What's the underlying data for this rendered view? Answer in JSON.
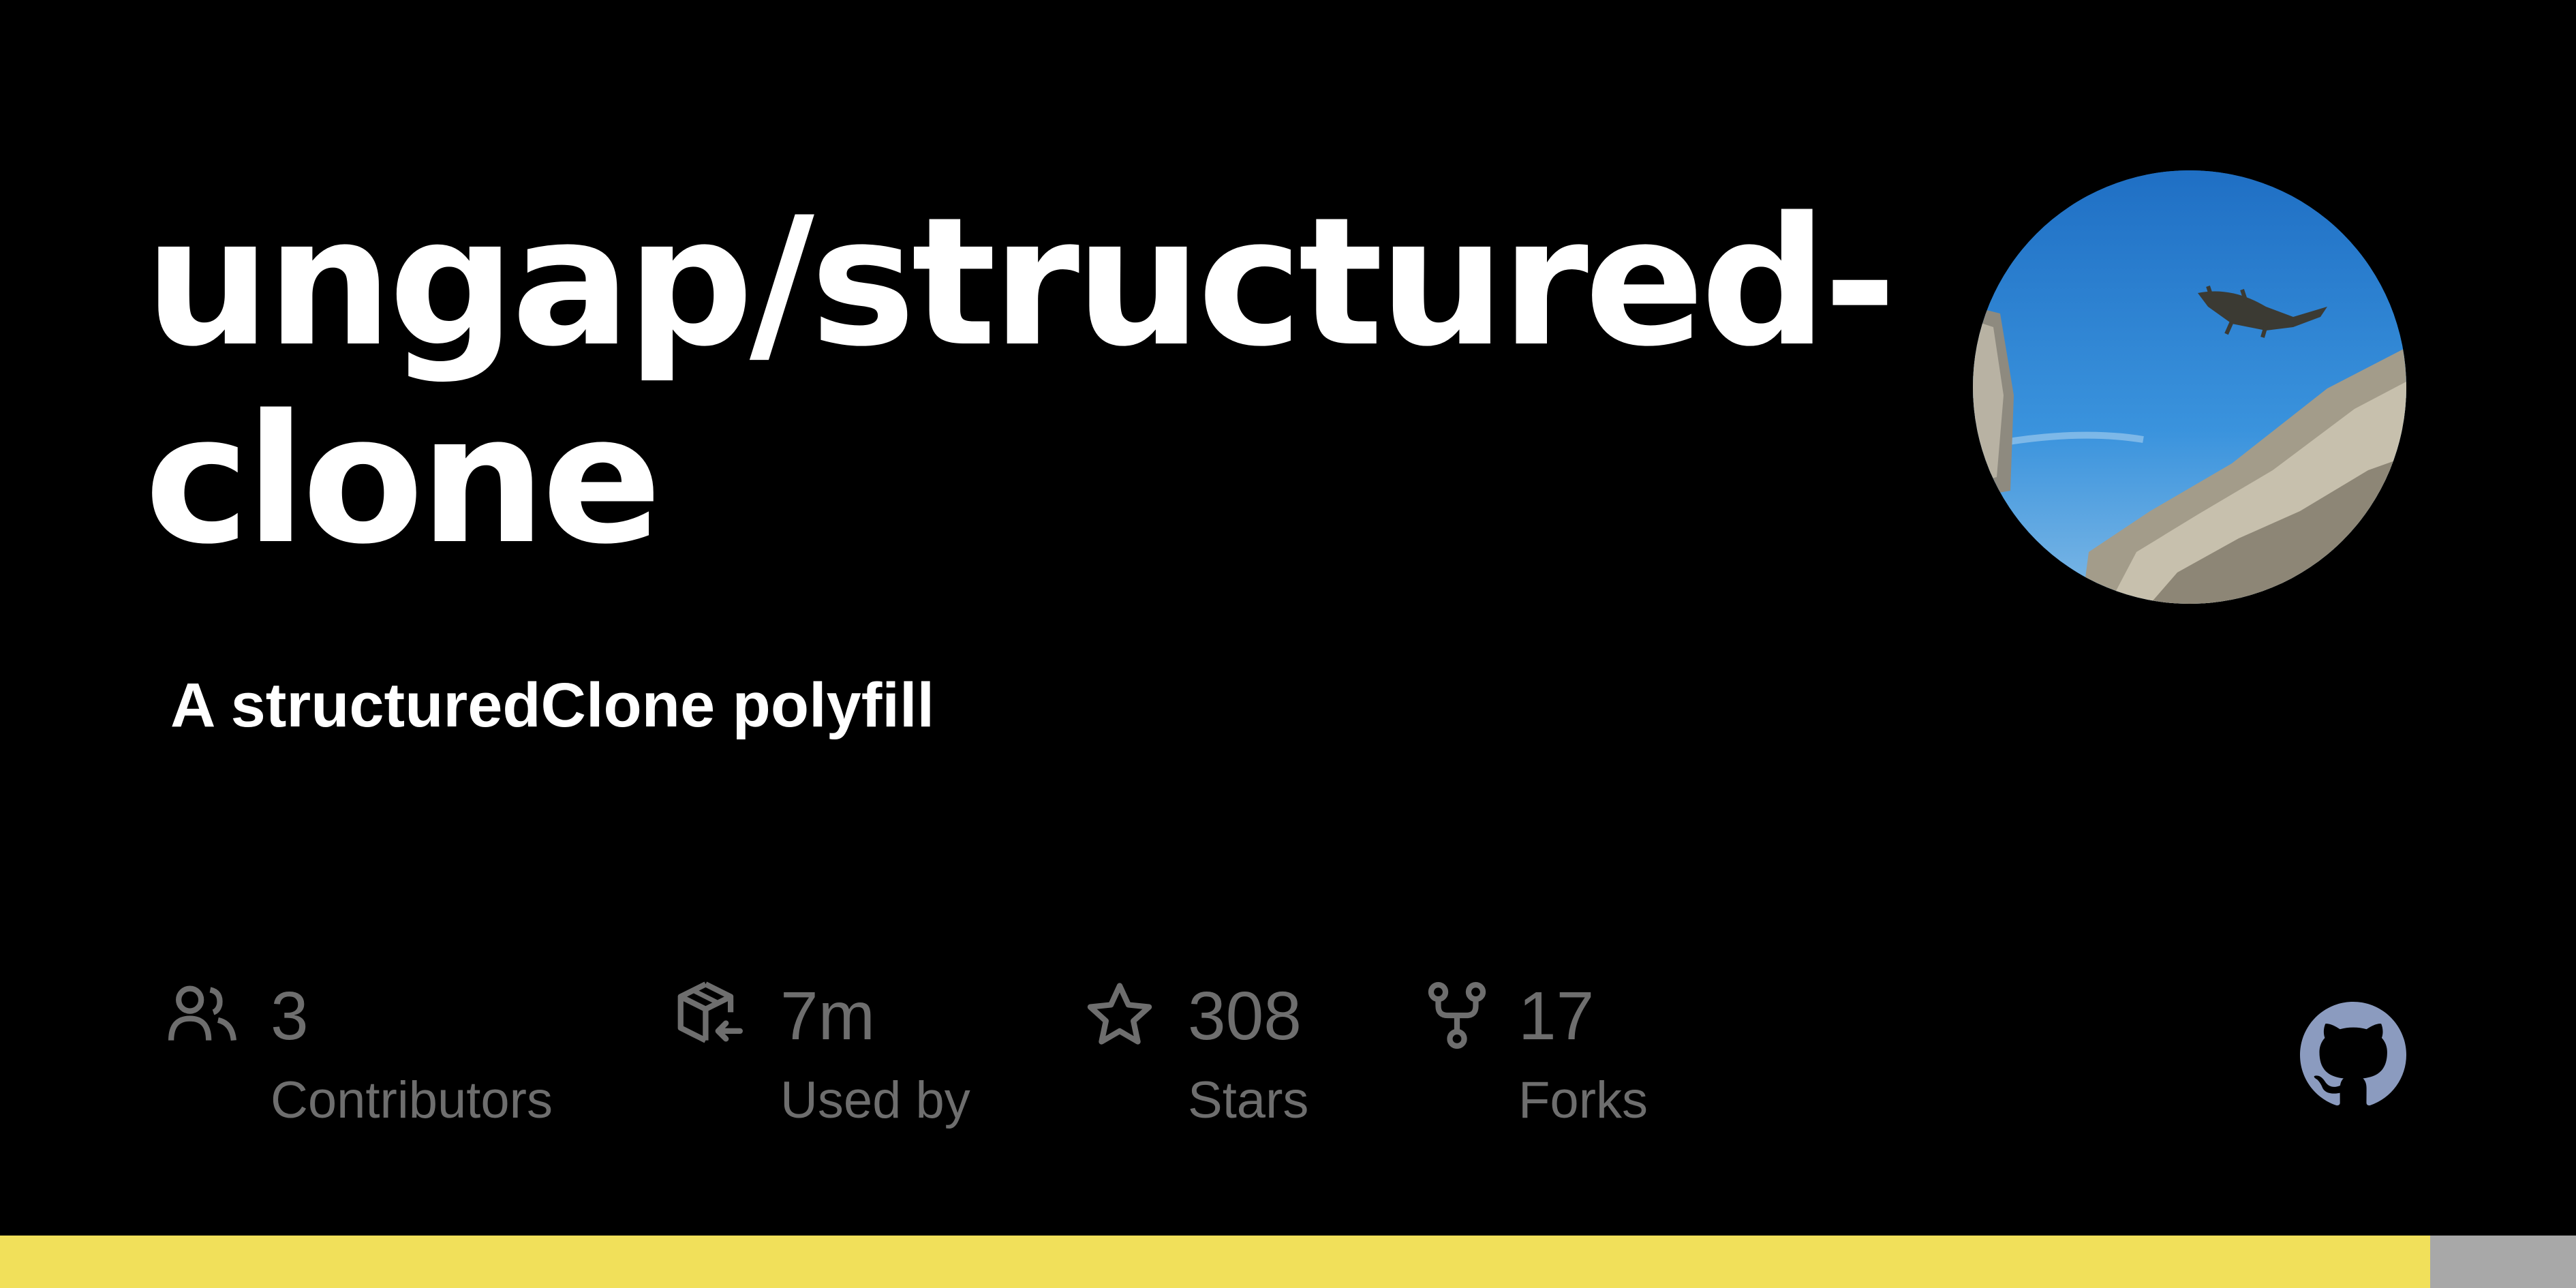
{
  "repo": {
    "title_line1": "ungap/structured-",
    "title_line2": "clone",
    "description": "A structuredClone polyfill"
  },
  "avatar": {
    "icon": "avatar-photo-lizard-leaping",
    "sky_color": "#2a7fd0",
    "rock_color": "#b9b2a0"
  },
  "stats": [
    {
      "icon": "people-icon",
      "value": "3",
      "label": "Contributors"
    },
    {
      "icon": "package-dependents-icon",
      "value": "7m",
      "label": "Used by"
    },
    {
      "icon": "star-icon",
      "value": "308",
      "label": "Stars"
    },
    {
      "icon": "repo-forked-icon",
      "value": "17",
      "label": "Forks"
    }
  ],
  "github_logo": {
    "icon": "github-mark-icon",
    "color": "#8b9bbf"
  },
  "language_bar": {
    "segments": [
      {
        "color": "#f1e05a",
        "fraction": 0.9434
      },
      {
        "color": "#a8a8a8",
        "fraction": 0.0566
      }
    ]
  },
  "colors": {
    "background": "#000000",
    "text_primary": "#ffffff",
    "text_muted": "#6e6e6e"
  }
}
